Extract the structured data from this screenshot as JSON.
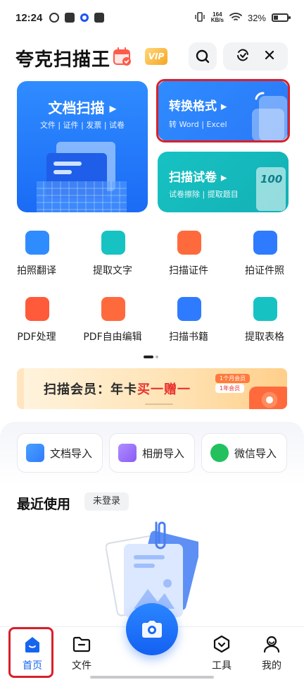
{
  "status_bar": {
    "time": "12:24",
    "net_speed_value": "164",
    "net_speed_unit": "KB/s",
    "battery": "32%"
  },
  "header": {
    "title": "夸克扫描王",
    "vip_label": "VIP"
  },
  "cards": {
    "doc_scan": {
      "title": "文档扫描",
      "subtitle": "文件 | 证件 | 发票 | 试卷"
    },
    "convert": {
      "title": "转换格式",
      "subtitle": "转 Word | Excel"
    },
    "exam_scan": {
      "title": "扫描试卷",
      "subtitle": "试卷擦除 | 提取题目",
      "sheet_score": "100"
    }
  },
  "tools": [
    {
      "label": "拍照翻译",
      "icon": "translate-icon",
      "color": "#2f8cff"
    },
    {
      "label": "提取文字",
      "icon": "text-extract-icon",
      "color": "#17c2c3"
    },
    {
      "label": "扫描证件",
      "icon": "id-card-icon",
      "color": "#ff6a3d"
    },
    {
      "label": "拍证件照",
      "icon": "id-photo-icon",
      "color": "#2f7bff"
    },
    {
      "label": "PDF处理",
      "icon": "pdf-icon",
      "color": "#ff5a3a"
    },
    {
      "label": "PDF自由编辑",
      "icon": "pdf-edit-icon",
      "color": "#ff6a3d"
    },
    {
      "label": "扫描书籍",
      "icon": "book-icon",
      "color": "#2f7bff"
    },
    {
      "label": "提取表格",
      "icon": "table-extract-icon",
      "color": "#17c2c3"
    }
  ],
  "banner": {
    "text_pre": "扫描会员：年卡",
    "text_highlight": "买一赠一",
    "chip_1": "1个月会员",
    "chip_2": "1年会员"
  },
  "imports": [
    {
      "label": "文档导入",
      "icon": "document-import-icon",
      "color": "#2f8cff"
    },
    {
      "label": "相册导入",
      "icon": "album-import-icon",
      "color": "#8a5cf6"
    },
    {
      "label": "微信导入",
      "icon": "wechat-import-icon",
      "color": "#22c15e"
    }
  ],
  "recent": {
    "title": "最近使用",
    "login_tag": "未登录"
  },
  "nav": {
    "home": "首页",
    "files": "文件",
    "tools": "工具",
    "mine": "我的"
  }
}
